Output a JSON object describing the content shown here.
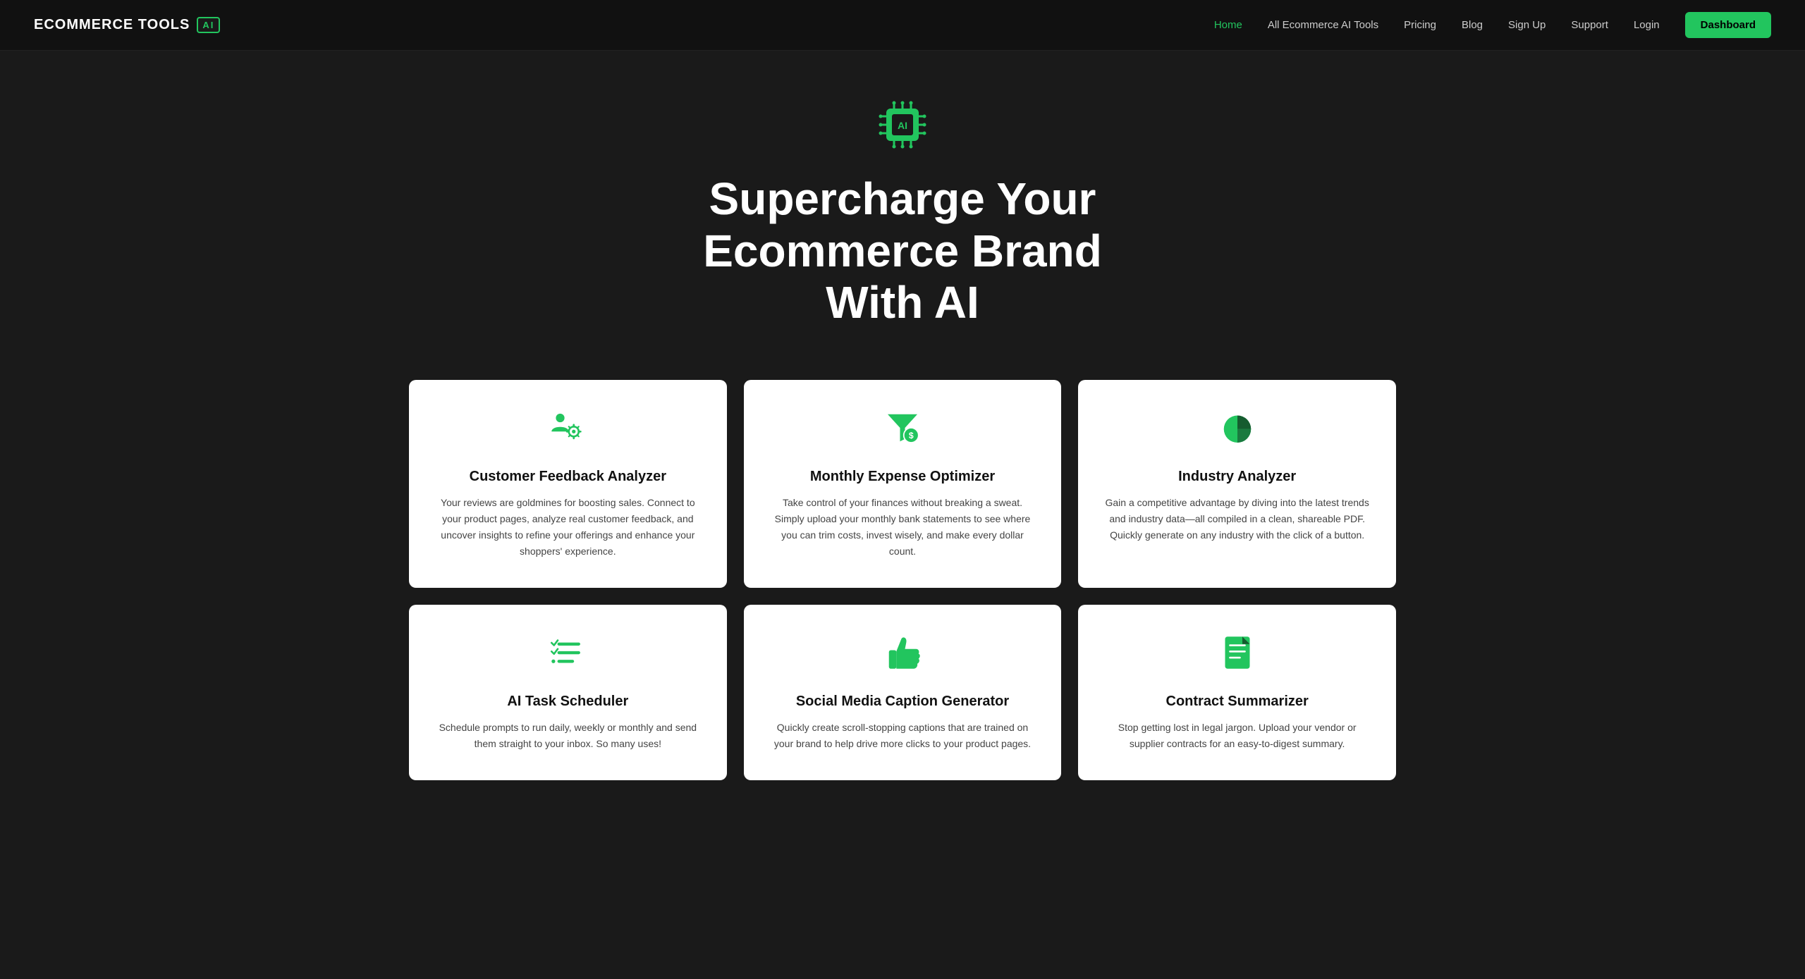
{
  "brand": {
    "name": "ECOMMERCE TOOLS",
    "badge": "AI"
  },
  "nav": {
    "links": [
      {
        "label": "Home",
        "active": true
      },
      {
        "label": "All Ecommerce AI Tools",
        "active": false
      },
      {
        "label": "Pricing",
        "active": false
      },
      {
        "label": "Blog",
        "active": false
      },
      {
        "label": "Sign Up",
        "active": false
      },
      {
        "label": "Support",
        "active": false
      },
      {
        "label": "Login",
        "active": false
      }
    ],
    "dashboard_label": "Dashboard"
  },
  "hero": {
    "title_line1": "Supercharge Your Ecommerce Brand",
    "title_line2": "With AI"
  },
  "cards": [
    {
      "id": "customer-feedback",
      "title": "Customer Feedback Analyzer",
      "description": "Your reviews are goldmines for boosting sales. Connect to your product pages, analyze real customer feedback, and uncover insights to refine your offerings and enhance your shoppers' experience.",
      "icon": "people-gear"
    },
    {
      "id": "monthly-expense",
      "title": "Monthly Expense Optimizer",
      "description": "Take control of your finances without breaking a sweat. Simply upload your monthly bank statements to see where you can trim costs, invest wisely, and make every dollar count.",
      "icon": "funnel-dollar"
    },
    {
      "id": "industry-analyzer",
      "title": "Industry Analyzer",
      "description": "Gain a competitive advantage by diving into the latest trends and industry data—all compiled in a clean, shareable PDF. Quickly generate on any industry with the click of a button.",
      "icon": "pie-chart"
    },
    {
      "id": "ai-task-scheduler",
      "title": "AI Task Scheduler",
      "description": "Schedule prompts to run daily, weekly or monthly and send them straight to your inbox. So many uses!",
      "icon": "checklist"
    },
    {
      "id": "social-media-caption",
      "title": "Social Media Caption Generator",
      "description": "Quickly create scroll-stopping captions that are trained on your brand to help drive more clicks to your product pages.",
      "icon": "thumbs-up"
    },
    {
      "id": "contract-summarizer",
      "title": "Contract Summarizer",
      "description": "Stop getting lost in legal jargon. Upload your vendor or supplier contracts for an easy-to-digest summary.",
      "icon": "document-lines"
    }
  ],
  "colors": {
    "accent": "#22c55e",
    "bg": "#1a1a1a",
    "nav_bg": "#111111",
    "card_bg": "#ffffff"
  }
}
